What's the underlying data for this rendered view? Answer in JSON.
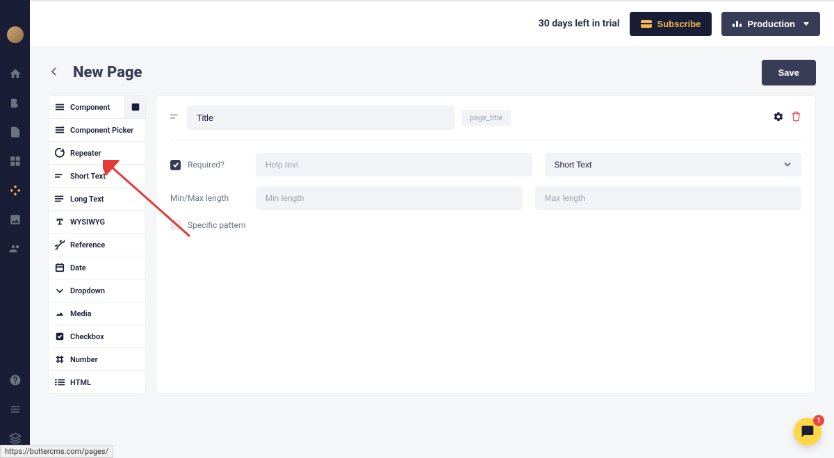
{
  "topbar": {
    "trial_text": "30 days left in trial",
    "subscribe_label": "Subscribe",
    "production_label": "Production"
  },
  "page": {
    "title": "New Page",
    "save_label": "Save"
  },
  "palette": {
    "items": [
      {
        "label": "Component"
      },
      {
        "label": "Component Picker"
      },
      {
        "label": "Repeater"
      },
      {
        "label": "Short Text"
      },
      {
        "label": "Long Text"
      },
      {
        "label": "WYSIWYG"
      },
      {
        "label": "Reference"
      },
      {
        "label": "Date"
      },
      {
        "label": "Dropdown"
      },
      {
        "label": "Media"
      },
      {
        "label": "Checkbox"
      },
      {
        "label": "Number"
      },
      {
        "label": "HTML"
      }
    ]
  },
  "editor": {
    "title_value": "Title",
    "slug": "page_title",
    "required_label": "Required?",
    "help_text_placeholder": "Help text",
    "type_selected": "Short Text",
    "minmax_label": "Min/Max length",
    "min_placeholder": "Min length",
    "max_placeholder": "Max length",
    "pattern_label": "Specific pattern"
  },
  "chat": {
    "badge_count": "1"
  },
  "status_url": "https://buttercms.com/pages/"
}
